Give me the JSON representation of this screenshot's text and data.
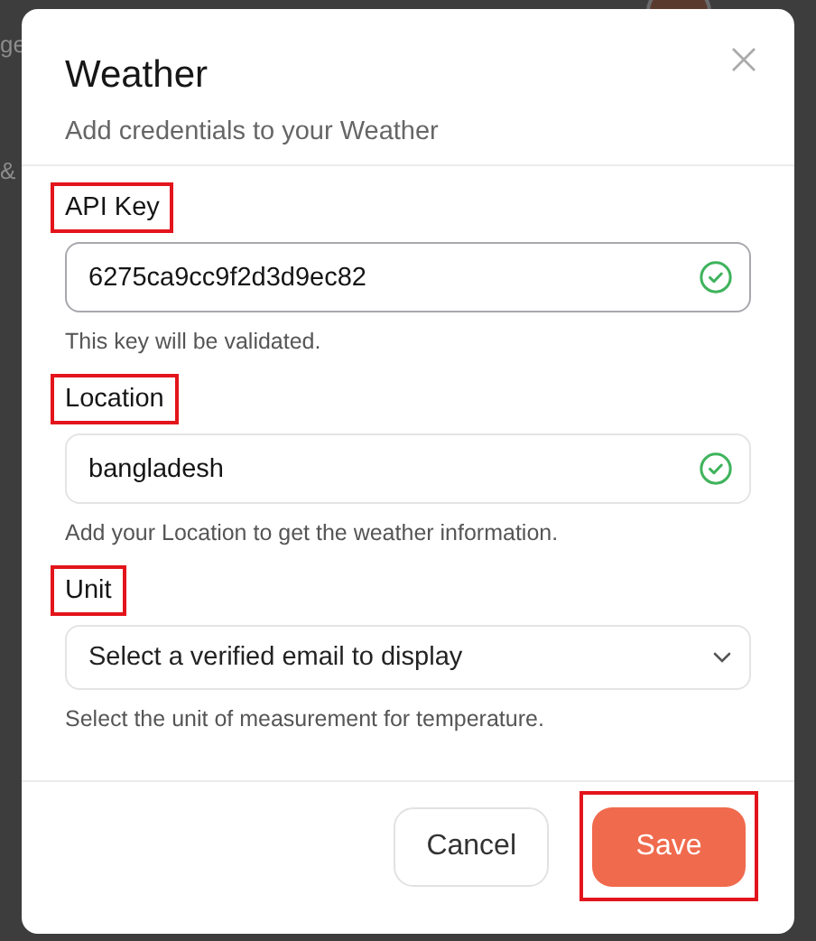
{
  "background": {
    "texts": [
      "ge",
      "&"
    ]
  },
  "dialog": {
    "title": "Weather",
    "subtitle": "Add credentials to your Weather",
    "fields": [
      {
        "kind": "input",
        "label": "API Key",
        "label_highlighted": true,
        "value": "6275ca9cc9f2d3d9ec82",
        "valid": true,
        "hint": "This key will be validated."
      },
      {
        "kind": "input",
        "label": "Location",
        "label_highlighted": true,
        "value": "bangladesh",
        "valid": true,
        "hint": "Add your Location to get the weather information."
      },
      {
        "kind": "select",
        "label": "Unit",
        "label_highlighted": true,
        "placeholder": "Select a verified email to display",
        "hint": "Select the unit of measurement for temperature."
      }
    ],
    "buttons": [
      {
        "kind": "secondary",
        "label": "Cancel",
        "highlighted": false
      },
      {
        "kind": "primary",
        "label": "Save",
        "highlighted": true
      }
    ]
  }
}
